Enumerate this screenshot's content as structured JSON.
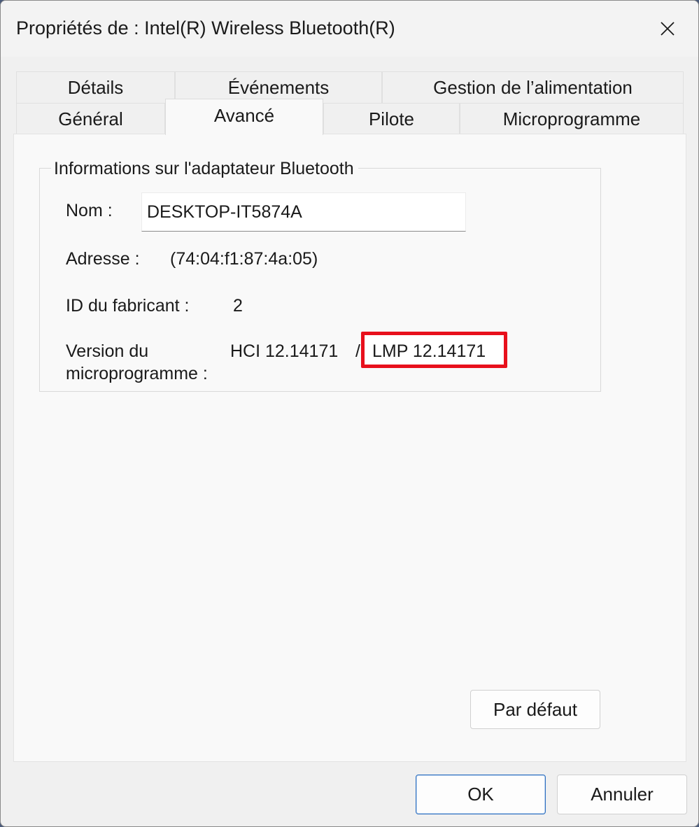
{
  "window": {
    "title": "Propriétés de : Intel(R) Wireless Bluetooth(R)"
  },
  "tabs": {
    "row1": [
      {
        "label": "Détails"
      },
      {
        "label": "Événements"
      },
      {
        "label": "Gestion de l’alimentation"
      }
    ],
    "row2": [
      {
        "label": "Général"
      },
      {
        "label": "Avancé",
        "active": true
      },
      {
        "label": "Pilote"
      },
      {
        "label": "Microprogramme"
      }
    ]
  },
  "adapter": {
    "group_title": "Informations sur l'adaptateur Bluetooth",
    "name_label": "Nom :",
    "name_value": "DESKTOP-IT5874A",
    "address_label": "Adresse :",
    "address_value": "(74:04:f1:87:4a:05)",
    "manufacturer_label": "ID du fabricant :",
    "manufacturer_value": "2",
    "firmware_label_line1": "Version du",
    "firmware_label_line2": "microprogramme :",
    "firmware_hci": "HCI 12.14171",
    "firmware_separator": "/",
    "firmware_lmp": "LMP 12.14171"
  },
  "buttons": {
    "default_label": "Par défaut",
    "ok_label": "OK",
    "cancel_label": "Annuler"
  },
  "colors": {
    "highlight": "#e8101c",
    "primary_border": "#2e6fbf"
  }
}
